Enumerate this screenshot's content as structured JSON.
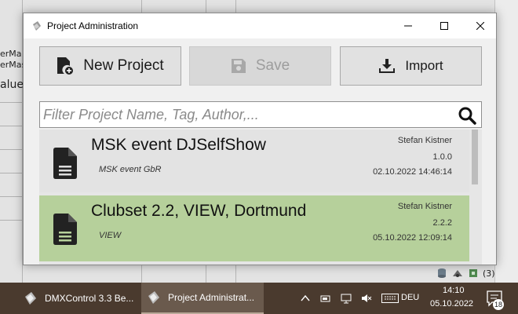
{
  "background_app": {
    "fragments": [
      "erMa",
      "erMas",
      "alue"
    ],
    "tray_count": "(3)"
  },
  "dialog": {
    "title": "Project Administration",
    "toolbar": {
      "new_project_label": "New Project",
      "save_label": "Save",
      "import_label": "Import"
    },
    "filter": {
      "placeholder": "Filter Project Name, Tag, Author,...",
      "value": ""
    },
    "projects": [
      {
        "name": "MSK event DJSelfShow",
        "organization": "MSK event GbR",
        "author": "Stefan Kistner",
        "version": "1.0.0",
        "date": "02.10.2022 14:46:14",
        "selected": false
      },
      {
        "name": "Clubset 2.2, VIEW, Dortmund",
        "organization": "VIEW",
        "author": "Stefan Kistner",
        "version": "2.2.2",
        "date": "05.10.2022 12:09:14",
        "selected": true
      }
    ]
  },
  "taskbar": {
    "apps": [
      {
        "label": "DMXControl 3.3 Be...",
        "icon": "dmxcontrol-icon"
      },
      {
        "label": "Project Administrat...",
        "icon": "dmxcontrol-icon",
        "active": true
      }
    ],
    "language": "DEU",
    "time": "14:10",
    "date": "05.10.2022",
    "notification_count": "18"
  },
  "colors": {
    "selected_row": "#b6d09b",
    "taskbar": "#4a3a2e",
    "dialog_bg": "#f0f0f0"
  }
}
